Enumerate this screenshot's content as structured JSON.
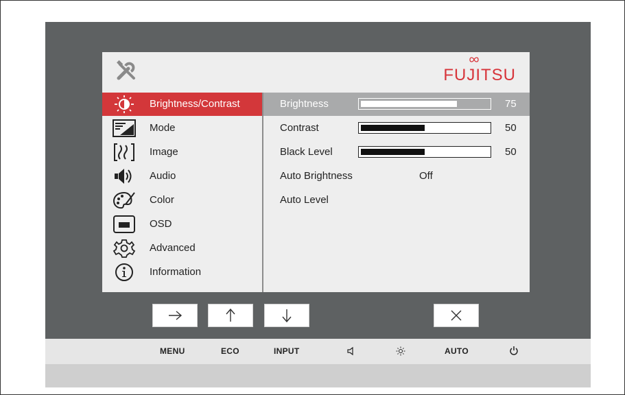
{
  "brand": {
    "logo_text": "FUJITSU"
  },
  "menu": {
    "items": [
      {
        "label": "Brightness/Contrast",
        "icon": "brightness-icon",
        "selected": true
      },
      {
        "label": "Mode",
        "icon": "mode-icon"
      },
      {
        "label": "Image",
        "icon": "image-icon"
      },
      {
        "label": "Audio",
        "icon": "audio-icon"
      },
      {
        "label": "Color",
        "icon": "color-palette-icon"
      },
      {
        "label": "OSD",
        "icon": "osd-icon"
      },
      {
        "label": "Advanced",
        "icon": "gear-icon"
      },
      {
        "label": "Information",
        "icon": "info-icon"
      }
    ]
  },
  "settings": {
    "brightness": {
      "label": "Brightness",
      "value": "75",
      "level": 0.75
    },
    "contrast": {
      "label": "Contrast",
      "value": "50",
      "level": 0.5
    },
    "black_level": {
      "label": "Black Level",
      "value": "50",
      "level": 0.5
    },
    "auto_brightness": {
      "label": "Auto Brightness",
      "value": "Off"
    },
    "auto_level": {
      "label": "Auto Level"
    }
  },
  "nav_buttons": [
    "right-arrow-icon",
    "up-arrow-icon",
    "down-arrow-icon",
    "close-icon"
  ],
  "keys": {
    "menu": "MENU",
    "eco": "ECO",
    "input": "INPUT",
    "speaker_icon": "speaker-icon",
    "brightness_icon": "sun-icon",
    "auto": "AUTO",
    "power_icon": "power-icon"
  },
  "colors": {
    "accent": "#d3373a",
    "selected_row": "#a9aaab",
    "bezel": "#5e6162",
    "panel": "#eeeeee"
  }
}
